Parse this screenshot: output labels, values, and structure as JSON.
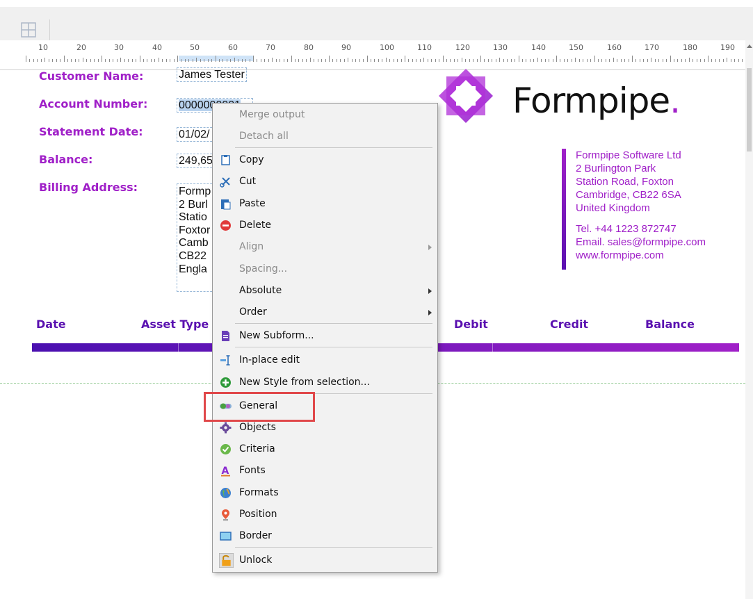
{
  "toolbar": {
    "icon": "grid-icon"
  },
  "ruler": {
    "marks": [
      "10",
      "20",
      "30",
      "40",
      "50",
      "60",
      "70",
      "80",
      "90",
      "100",
      "110",
      "120",
      "130",
      "140",
      "150",
      "160",
      "170",
      "180",
      "190",
      "20"
    ]
  },
  "form": {
    "fields": [
      {
        "label": "Customer Name:",
        "value": "James Tester"
      },
      {
        "label": "Account Number:",
        "value": "0000000001"
      },
      {
        "label": "Statement Date:",
        "value": "01/02/"
      },
      {
        "label": "Balance:",
        "value": "249,65"
      },
      {
        "label": "Billing Address:"
      }
    ],
    "address_lines": [
      "Formp",
      "2 Burl",
      "Statio",
      "Foxtor",
      "Camb",
      "CB22",
      "Engla"
    ]
  },
  "logo": {
    "brand_text": "Formpipe",
    "brand_dot": "."
  },
  "company": {
    "lines": [
      "Formpipe Software Ltd",
      "2 Burlington Park",
      "Station Road, Foxton",
      "Cambridge, CB22 6SA",
      "United Kingdom"
    ],
    "contact": [
      "Tel. +44 1223 872747",
      "Email. sales@formpipe.com",
      "www.formpipe.com"
    ]
  },
  "table": {
    "headers": [
      "Date",
      "Asset Type",
      "Debit",
      "Credit",
      "Balance"
    ]
  },
  "context_menu": {
    "items": [
      {
        "label": "Merge output",
        "icon": "",
        "disabled": true
      },
      {
        "label": "Detach all",
        "icon": "",
        "disabled": true
      },
      {
        "label": "Copy",
        "icon": "copy-icon"
      },
      {
        "label": "Cut",
        "icon": "scissors-icon"
      },
      {
        "label": "Paste",
        "icon": "paste-icon"
      },
      {
        "label": "Delete",
        "icon": "delete-icon"
      },
      {
        "label": "Align",
        "icon": "",
        "disabled": true,
        "submenu": true
      },
      {
        "label": "Spacing...",
        "icon": "",
        "disabled": true
      },
      {
        "label": "Absolute",
        "icon": "",
        "submenu": true
      },
      {
        "label": "Order",
        "icon": "",
        "submenu": true
      },
      {
        "label": "New Subform...",
        "icon": "subform-icon"
      },
      {
        "label": "In-place edit",
        "icon": "text-cursor-icon"
      },
      {
        "label": "New Style from selection...",
        "icon": "add-icon"
      },
      {
        "label": "General",
        "icon": "toggle-icon"
      },
      {
        "label": "Objects",
        "icon": "gear-icon"
      },
      {
        "label": "Criteria",
        "icon": "check-badge-icon"
      },
      {
        "label": "Fonts",
        "icon": "font-icon"
      },
      {
        "label": "Formats",
        "icon": "globe-icon"
      },
      {
        "label": "Position",
        "icon": "pin-icon"
      },
      {
        "label": "Border",
        "icon": "border-icon"
      },
      {
        "label": "Unlock",
        "icon": "unlock-icon"
      }
    ]
  },
  "colors": {
    "accent": "#a020c8",
    "deep": "#5a10b0",
    "highlight": "#e0484a"
  }
}
